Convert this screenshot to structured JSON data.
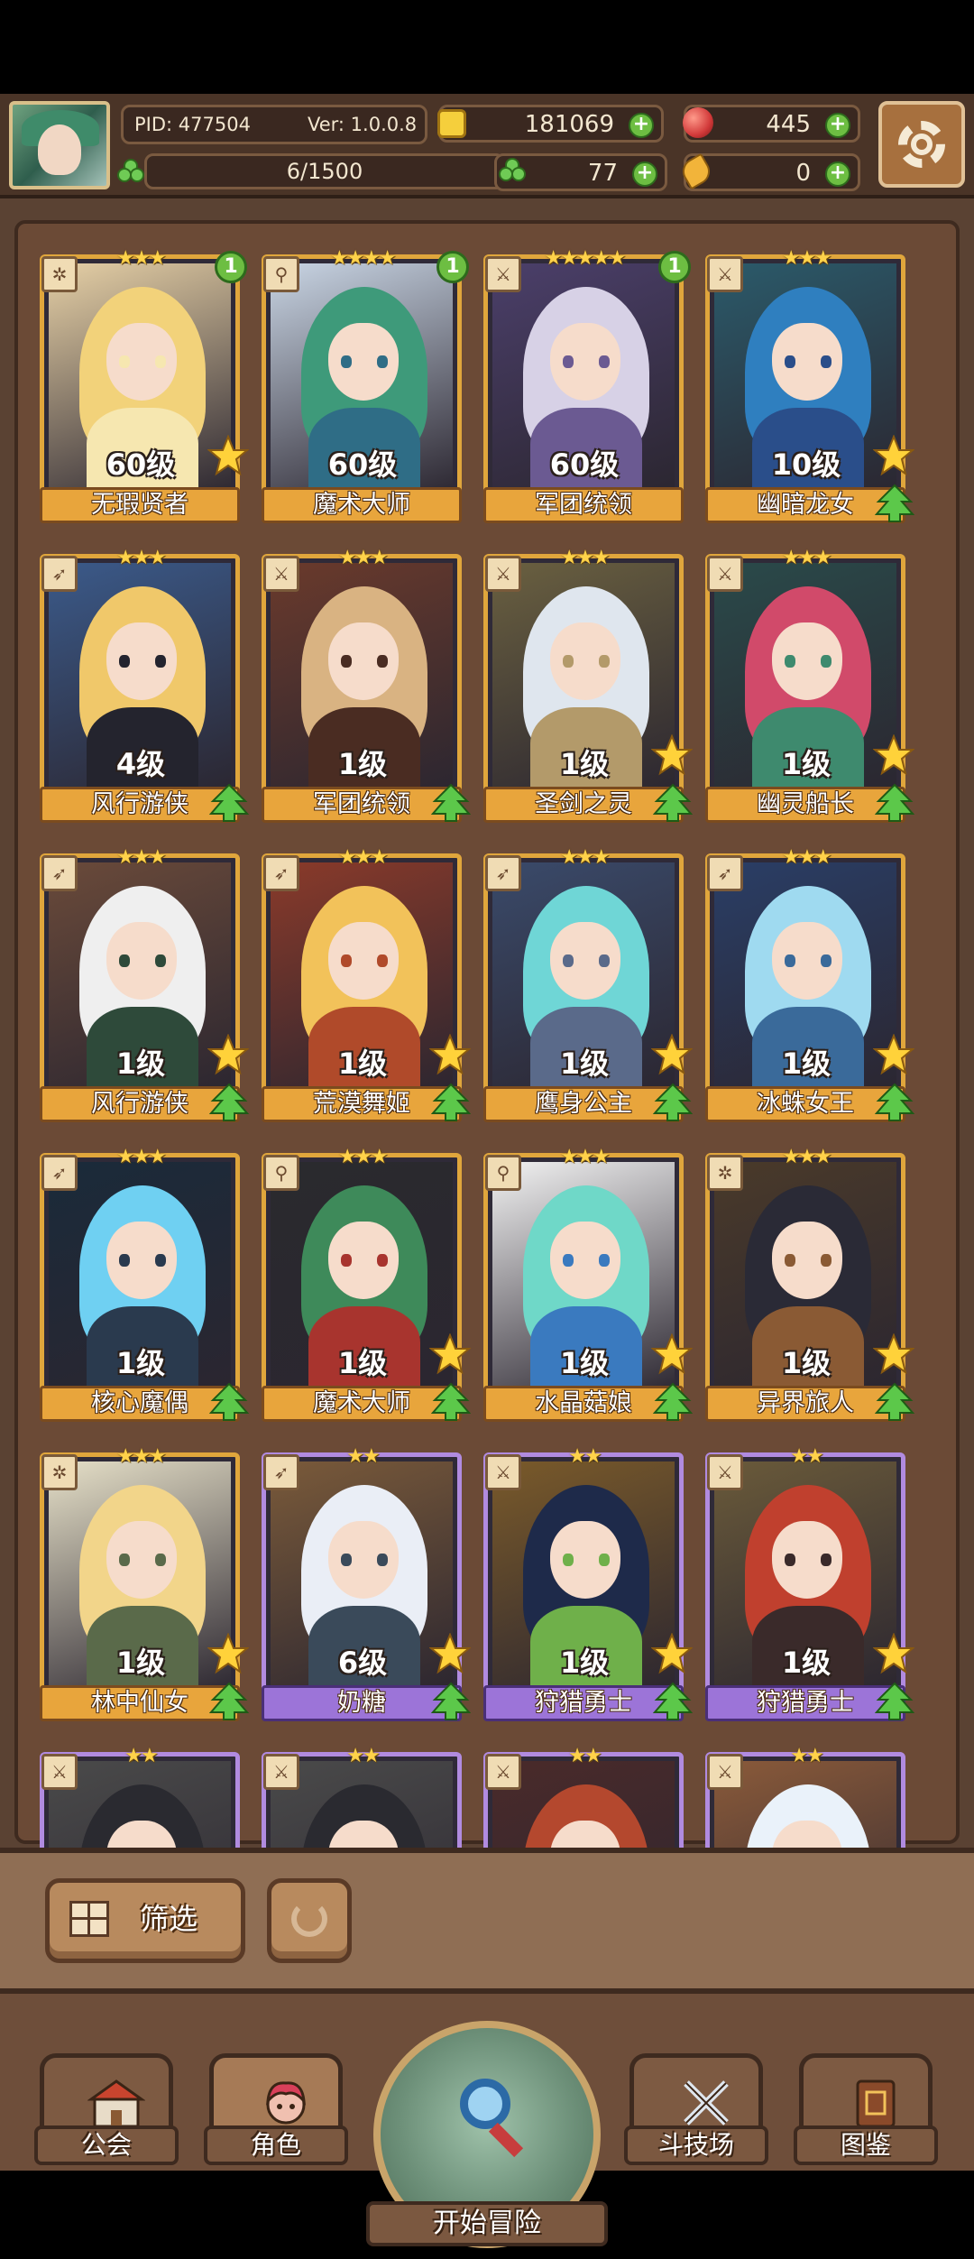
{
  "header": {
    "pid_label": "PID: 477504",
    "version_label": "Ver: 1.0.0.8",
    "gold": "181069",
    "gems": "445",
    "exp": "6/1500",
    "clover_count": "77",
    "feather_count": "0"
  },
  "heroes": [
    {
      "name": "无瑕贤者",
      "level": "60级",
      "stars": "★★★",
      "badge": "1",
      "class_icon": "gear-class-icon",
      "frame": "gold",
      "palette": [
        "#f2d27a",
        "#f6e7b0",
        "#e6d0a6"
      ],
      "gold_star": true,
      "upgrade": false
    },
    {
      "name": "魔术大师",
      "level": "60级",
      "stars": "★★★★",
      "badge": "1",
      "class_icon": "wand-class-icon",
      "frame": "gold",
      "palette": [
        "#3e9a7a",
        "#2f6d86",
        "#c9d5e4"
      ],
      "gold_star": false,
      "upgrade": false
    },
    {
      "name": "军团统领",
      "level": "60级",
      "stars": "★★★★★",
      "badge": "1",
      "class_icon": "sword-class-icon",
      "frame": "gold",
      "palette": [
        "#d7d1e6",
        "#6b5a92",
        "#4b3f6a"
      ],
      "gold_star": false,
      "upgrade": false
    },
    {
      "name": "幽暗龙女",
      "level": "10级",
      "stars": "★★★",
      "badge": "",
      "class_icon": "sword-class-icon",
      "frame": "gold",
      "palette": [
        "#2f7fbf",
        "#2a4e8a",
        "#2b5a6a"
      ],
      "gold_star": true,
      "upgrade": true
    },
    {
      "name": "风行游侠",
      "level": "4级",
      "stars": "★★★",
      "badge": "",
      "class_icon": "bow-class-icon",
      "frame": "gold",
      "palette": [
        "#f0c86a",
        "#24242e",
        "#3b5a8a"
      ],
      "gold_star": false,
      "upgrade": true
    },
    {
      "name": "军团统领",
      "level": "1级",
      "stars": "★★★",
      "badge": "",
      "class_icon": "sword-class-icon",
      "frame": "gold",
      "palette": [
        "#d9b382",
        "#4a2c22",
        "#6a3a2c"
      ],
      "gold_star": false,
      "upgrade": true
    },
    {
      "name": "圣剑之灵",
      "level": "1级",
      "stars": "★★★",
      "badge": "",
      "class_icon": "sword-class-icon",
      "frame": "gold",
      "palette": [
        "#dfe6ee",
        "#b39a6a",
        "#6a6040"
      ],
      "gold_star": true,
      "upgrade": true
    },
    {
      "name": "幽灵船长",
      "level": "1级",
      "stars": "★★★",
      "badge": "",
      "class_icon": "sword-class-icon",
      "frame": "gold",
      "palette": [
        "#d14a6a",
        "#3e8a6e",
        "#2a4a4a"
      ],
      "gold_star": true,
      "upgrade": true
    },
    {
      "name": "风行游侠",
      "level": "1级",
      "stars": "★★★",
      "badge": "",
      "class_icon": "bow-class-icon",
      "frame": "gold",
      "palette": [
        "#efefef",
        "#2e4a3a",
        "#6a4a3a"
      ],
      "gold_star": true,
      "upgrade": true
    },
    {
      "name": "荒漠舞姬",
      "level": "1级",
      "stars": "★★★",
      "badge": "",
      "class_icon": "bow-class-icon",
      "frame": "gold",
      "palette": [
        "#f2c25a",
        "#b04a2a",
        "#8a3a2a"
      ],
      "gold_star": true,
      "upgrade": true
    },
    {
      "name": "鹰身公主",
      "level": "1级",
      "stars": "★★★",
      "badge": "",
      "class_icon": "bow-class-icon",
      "frame": "gold",
      "palette": [
        "#6fd6d6",
        "#5a6a8a",
        "#3a4a6a"
      ],
      "gold_star": true,
      "upgrade": true
    },
    {
      "name": "冰蛛女王",
      "level": "1级",
      "stars": "★★★",
      "badge": "",
      "class_icon": "bow-class-icon",
      "frame": "gold",
      "palette": [
        "#9fdaf0",
        "#3a6a9a",
        "#2a3e66"
      ],
      "gold_star": true,
      "upgrade": true
    },
    {
      "name": "核心魔偶",
      "level": "1级",
      "stars": "★★★",
      "badge": "",
      "class_icon": "bow-class-icon",
      "frame": "gold",
      "palette": [
        "#6fd0f2",
        "#2a3a4e",
        "#1a2a3a"
      ],
      "gold_star": false,
      "upgrade": true
    },
    {
      "name": "魔术大师",
      "level": "1级",
      "stars": "★★★",
      "badge": "",
      "class_icon": "wand-class-icon",
      "frame": "gold",
      "palette": [
        "#3e8a5a",
        "#a8342e",
        "#2a2a2e"
      ],
      "gold_star": true,
      "upgrade": true
    },
    {
      "name": "水晶菇娘",
      "level": "1级",
      "stars": "★★★",
      "badge": "",
      "class_icon": "wand-class-icon",
      "frame": "gold",
      "palette": [
        "#6fd8c8",
        "#3a7abf",
        "#f2f2f2"
      ],
      "gold_star": true,
      "upgrade": true
    },
    {
      "name": "异界旅人",
      "level": "1级",
      "stars": "★★★",
      "badge": "",
      "class_icon": "gear-class-icon",
      "frame": "gold",
      "palette": [
        "#2a2a36",
        "#8a5a34",
        "#4a3a2a"
      ],
      "gold_star": true,
      "upgrade": true
    },
    {
      "name": "林中仙女",
      "level": "1级",
      "stars": "★★★",
      "badge": "",
      "class_icon": "gear-class-icon",
      "frame": "gold",
      "palette": [
        "#f2d58a",
        "#5a6a4a",
        "#e6e0c8"
      ],
      "gold_star": true,
      "upgrade": true
    },
    {
      "name": "奶糖",
      "level": "6级",
      "stars": "★★",
      "badge": "",
      "class_icon": "bow-class-icon",
      "frame": "purple",
      "palette": [
        "#eaeef6",
        "#3a4a5a",
        "#7a5a3a"
      ],
      "gold_star": true,
      "upgrade": true
    },
    {
      "name": "狩猎勇士",
      "level": "1级",
      "stars": "★★",
      "badge": "",
      "class_icon": "sword-class-icon",
      "frame": "purple",
      "palette": [
        "#1e2a4a",
        "#6fb04a",
        "#7a5a2a"
      ],
      "gold_star": true,
      "upgrade": true
    },
    {
      "name": "狩猎勇士",
      "level": "1级",
      "stars": "★★",
      "badge": "",
      "class_icon": "sword-class-icon",
      "frame": "purple",
      "palette": [
        "#c0402e",
        "#3a2a2a",
        "#6a5a3a"
      ],
      "gold_star": true,
      "upgrade": true
    },
    {
      "name": "",
      "level": "",
      "stars": "★★",
      "badge": "",
      "class_icon": "sword-class-icon",
      "frame": "purple",
      "palette": [
        "#2a2a30",
        "#f2f2f2",
        "#4a4a4a"
      ],
      "gold_star": false,
      "upgrade": false
    },
    {
      "name": "",
      "level": "",
      "stars": "★★",
      "badge": "",
      "class_icon": "sword-class-icon",
      "frame": "purple",
      "palette": [
        "#2a2a30",
        "#eae6e0",
        "#4a4a4a"
      ],
      "gold_star": false,
      "upgrade": false
    },
    {
      "name": "",
      "level": "",
      "stars": "★★",
      "badge": "",
      "class_icon": "sword-class-icon",
      "frame": "purple",
      "palette": [
        "#b4482e",
        "#6a2a2a",
        "#4a2a2a"
      ],
      "gold_star": false,
      "upgrade": false
    },
    {
      "name": "",
      "level": "",
      "stars": "★★",
      "badge": "",
      "class_icon": "sword-class-icon",
      "frame": "purple",
      "palette": [
        "#eaf2fa",
        "#6a9ac0",
        "#8a5a3a"
      ],
      "gold_star": false,
      "upgrade": false
    }
  ],
  "filter": {
    "label": "筛选"
  },
  "nav": {
    "guild": "公会",
    "character": "角色",
    "adventure": "开始冒险",
    "arena": "斗技场",
    "codex": "图鉴"
  },
  "colors": {
    "gold_frame": "#e0a63c",
    "purple_frame": "#b18be0",
    "panel": "#6b4a36"
  }
}
